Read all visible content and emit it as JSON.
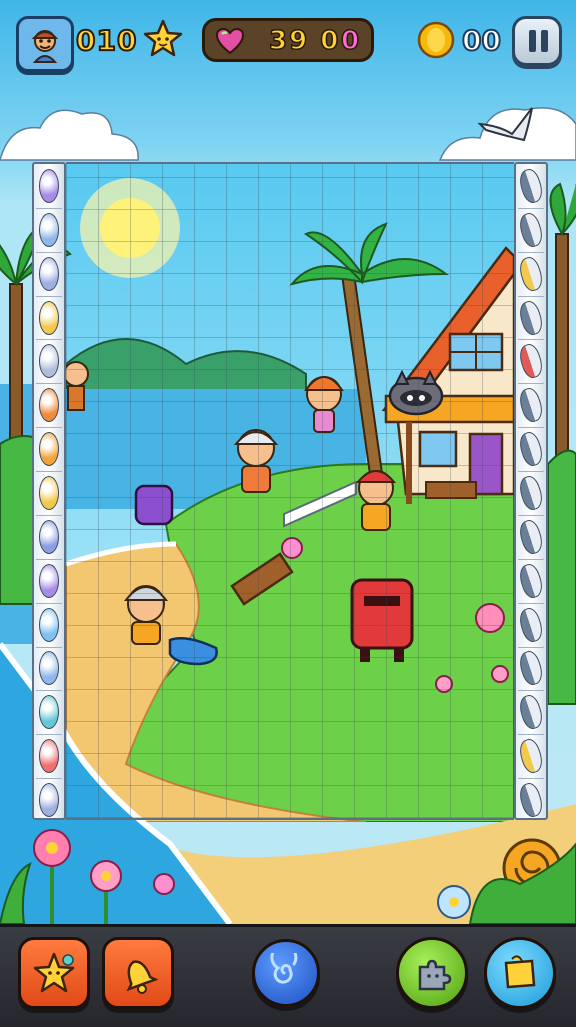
{
  "hud": {
    "score": "010",
    "lives": "39 0",
    "gems": "0",
    "coins": "00",
    "icons": {
      "avatar": "player-avatar-icon",
      "star": "star-icon",
      "heart": "heart-icon",
      "coin": "coin-icon",
      "pause": "pause-icon"
    }
  },
  "board": {
    "grid_columns": 14,
    "grid_rows": 20,
    "left_rail_slot_colors": [
      "#a78be8",
      "#8fb7ea",
      "#9fb0e0",
      "#f2c94c",
      "#b0bedb",
      "#f28c3a",
      "#f2a33a",
      "#f2c94c",
      "#8d9fe4",
      "#a78be8",
      "#7fc1f0",
      "#8fb7ea",
      "#66c7d6",
      "#f07070",
      "#9fb0e0"
    ],
    "right_rail_slot_colors": [
      "#6b7f99",
      "#6b7f99",
      "#f2c94c",
      "#6b7f99",
      "#e05a5a",
      "#6b7f99",
      "#6b7f99",
      "#6b7f99",
      "#6b7f99",
      "#6b7f99",
      "#6b7f99",
      "#6b7f99",
      "#6b7f99",
      "#f2c94c",
      "#6b7f99"
    ]
  },
  "toolbar": {
    "buttons": [
      {
        "name": "star-hint-button",
        "icon": "star-icon",
        "color": "#ff7b3d"
      },
      {
        "name": "bell-button",
        "icon": "bell-icon",
        "color": "#ff7b3d"
      },
      {
        "name": "spiral-shuffle-button",
        "icon": "spiral-icon",
        "color": "#2f6fe0"
      },
      {
        "name": "piece-sort-button",
        "icon": "puzzle-piece-icon",
        "color": "#7ed321"
      },
      {
        "name": "edge-pieces-button",
        "icon": "edge-piece-icon",
        "color": "#2fb8ef"
      }
    ]
  },
  "colors": {
    "hud_text_yellow": "#ffd23a",
    "gem_pink": "#ff6ad6",
    "outline_dark": "#2b1a08"
  }
}
